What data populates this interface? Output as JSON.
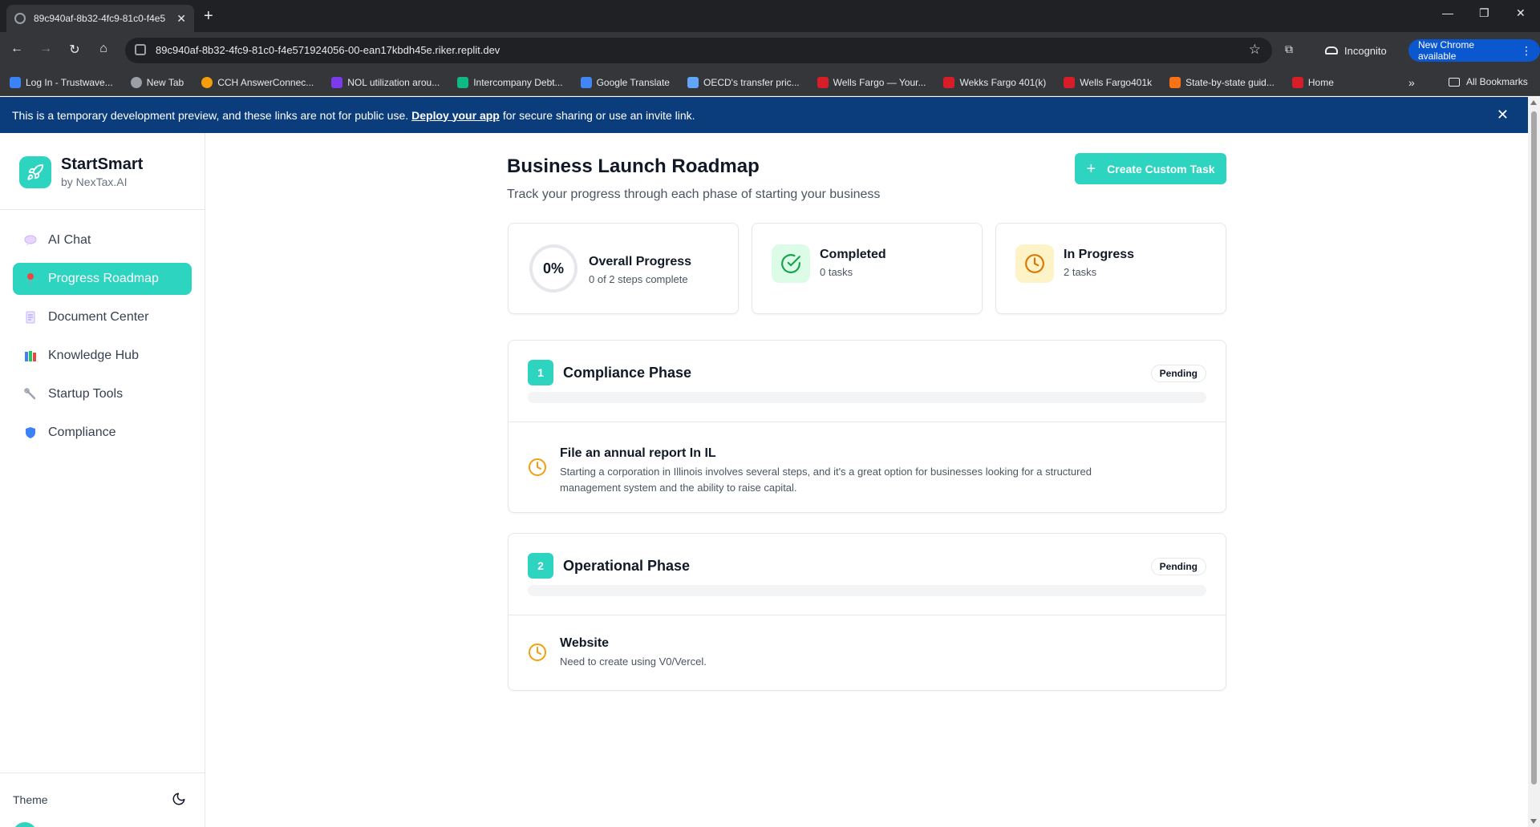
{
  "browser": {
    "tab_title": "89c940af-8b32-4fc9-81c0-f4e5",
    "url": "89c940af-8b32-4fc9-81c0-f4e571924056-00-ean17kbdh45e.riker.replit.dev",
    "incognito_label": "Incognito",
    "new_chrome_label": "New Chrome available",
    "bookmarks": [
      {
        "label": "Log In - Trustwave...",
        "color": "#3b82f6"
      },
      {
        "label": "New Tab",
        "color": "#9aa0a6"
      },
      {
        "label": "CCH AnswerConnec...",
        "color": "#f59e0b"
      },
      {
        "label": "NOL utilization arou...",
        "color": "#7c3aed"
      },
      {
        "label": "Intercompany Debt...",
        "color": "#10b981"
      },
      {
        "label": "Google Translate",
        "color": "#4285f4"
      },
      {
        "label": "OECD's transfer pric...",
        "color": "#60a5fa"
      },
      {
        "label": "Wells Fargo — Your...",
        "color": "#d71e28"
      },
      {
        "label": "Wekks Fargo 401(k)",
        "color": "#d71e28"
      },
      {
        "label": "Wells Fargo401k",
        "color": "#d71e28"
      },
      {
        "label": "State-by-state guid...",
        "color": "#f97316"
      },
      {
        "label": "Home",
        "color": "#d71e28"
      }
    ],
    "all_bookmarks_label": "All Bookmarks"
  },
  "banner": {
    "text_before": "This is a temporary development preview, and these links are not for public use.",
    "link": "Deploy your app",
    "text_after": "for secure sharing or use an invite link."
  },
  "sidebar": {
    "brand_name": "StartSmart",
    "brand_sub": "by NexTax.AI",
    "items": [
      {
        "label": "AI Chat",
        "icon": "speech-bubble-icon",
        "active": false
      },
      {
        "label": "Progress Roadmap",
        "icon": "pin-icon",
        "active": true
      },
      {
        "label": "Document Center",
        "icon": "document-icon",
        "active": false
      },
      {
        "label": "Knowledge Hub",
        "icon": "books-icon",
        "active": false
      },
      {
        "label": "Startup Tools",
        "icon": "wrench-icon",
        "active": false
      },
      {
        "label": "Compliance",
        "icon": "shield-icon",
        "active": false
      }
    ],
    "theme_label": "Theme"
  },
  "main": {
    "title": "Business Launch Roadmap",
    "subtitle": "Track your progress through each phase of starting your business",
    "create_button": "Create Custom Task",
    "stats": {
      "overall": {
        "value": "0%",
        "title": "Overall Progress",
        "sub": "0 of 2 steps complete"
      },
      "completed": {
        "title": "Completed",
        "sub": "0 tasks"
      },
      "in_progress": {
        "title": "In Progress",
        "sub": "2 tasks"
      }
    },
    "phases": [
      {
        "number": "1",
        "name": "Compliance Phase",
        "status": "Pending",
        "progress": 0,
        "tasks": [
          {
            "title": "File an annual report In IL",
            "description": "Starting a corporation in Illinois involves several steps, and it's a great option for businesses looking for a structured management system and the ability to raise capital."
          }
        ]
      },
      {
        "number": "2",
        "name": "Operational Phase",
        "status": "Pending",
        "progress": 0,
        "tasks": [
          {
            "title": "Website",
            "description": "Need to create using V0/Vercel."
          }
        ]
      }
    ]
  },
  "colors": {
    "accent": "#2dd4bf",
    "banner": "#0b3d7c",
    "pending_icon": "#f59e0b",
    "completed_icon": "#16a34a"
  }
}
